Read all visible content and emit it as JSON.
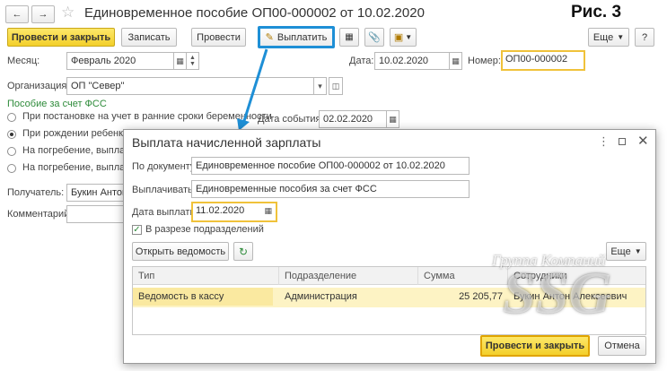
{
  "corner_label": "Рис. 3",
  "window": {
    "title": "Единовременное пособие ОП00-000002 от 10.02.2020",
    "star_icon": "star-icon"
  },
  "toolbar": {
    "post_close": "Провести и закрыть",
    "save": "Записать",
    "post": "Провести",
    "pay": "Выплатить",
    "more": "Еще",
    "help": "?"
  },
  "form": {
    "month_label": "Месяц:",
    "month_value": "Февраль 2020",
    "date_label": "Дата:",
    "date_value": "10.02.2020",
    "number_label": "Номер:",
    "number_value": "ОП00-000002",
    "org_label": "Организация:",
    "org_value": "ОП \"Север\"",
    "fss_title": "Пособие за счет ФСС",
    "options": [
      "При постановке на учет в ранние сроки беременности",
      "При рождении ребенка",
      "На погребение, выплачи",
      "На погребение, выплачи"
    ],
    "event_date_label": "Дата события:",
    "event_date_value": "02.02.2020",
    "recipient_label": "Получатель:",
    "recipient_value": "Букин Антон",
    "comment_label": "Комментарий:"
  },
  "dialog": {
    "title": "Выплата начисленной зарплаты",
    "doc_label": "По документу:",
    "doc_value": "Единовременное пособие ОП00-000002 от 10.02.2020",
    "pay_label": "Выплачивать:",
    "pay_value": "Единовременные пособия за счет ФСС",
    "pay_date_label": "Дата выплаты:",
    "pay_date_value": "11.02.2020",
    "by_dept_label": "В разрезе подразделений",
    "open_sheet": "Открыть ведомость",
    "more": "Еще",
    "columns": [
      "Тип",
      "Подразделение",
      "Сумма",
      "Сотрудники"
    ],
    "rows": [
      [
        "Ведомость в кассу",
        "Администрация",
        "25 205,77",
        "Букин Антон Алексеевич"
      ]
    ],
    "post_close": "Провести и закрыть",
    "cancel": "Отмена"
  },
  "watermark": {
    "line1": "Группа Компаний",
    "line2": "SSG"
  },
  "colors": {
    "highlight_blue": "#1e8fd6",
    "accent_yellow": "#f3cf2a",
    "field_highlight": "#f0c23a",
    "row_selected": "#fdf3c4",
    "section_green": "#2e8b3a"
  }
}
